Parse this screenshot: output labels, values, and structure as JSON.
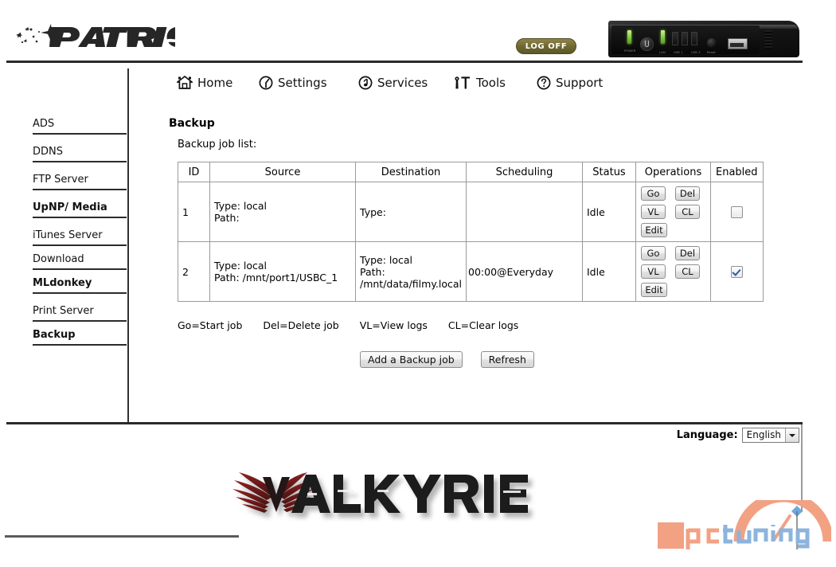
{
  "header": {
    "brand": "PATRIOT",
    "logoff_label": "LOG OFF",
    "device_labels": [
      "POWER",
      "LAN",
      "USB 1",
      "USB 2",
      "Reset"
    ]
  },
  "topnav": [
    {
      "label": "Home",
      "icon": "house-icon"
    },
    {
      "label": "Settings",
      "icon": "clock-icon"
    },
    {
      "label": "Services",
      "icon": "music-note-circle-icon"
    },
    {
      "label": "Tools",
      "icon": "wrench-screwdriver-icon"
    },
    {
      "label": "Support",
      "icon": "question-circle-icon"
    }
  ],
  "sidebar": {
    "items": [
      {
        "label": "ADS",
        "bold": false,
        "active": false
      },
      {
        "label": "DDNS",
        "bold": false,
        "active": false
      },
      {
        "label": "FTP Server",
        "bold": false,
        "active": false
      },
      {
        "label": "UpNP/ Media",
        "bold": true,
        "active": false
      },
      {
        "label": "iTunes Server",
        "bold": false,
        "active": false
      },
      {
        "label": "Download",
        "bold": false,
        "active": false
      },
      {
        "label": "MLdonkey",
        "bold": true,
        "active": false
      },
      {
        "label": "Print Server",
        "bold": false,
        "active": false
      },
      {
        "label": "Backup",
        "bold": true,
        "active": true
      }
    ]
  },
  "main": {
    "title": "Backup",
    "list_label": "Backup job list:",
    "table": {
      "headers": [
        "ID",
        "Source",
        "Destination",
        "Scheduling",
        "Status",
        "Operations",
        "Enabled"
      ],
      "rows": [
        {
          "id": "1",
          "source_type": "Type: local",
          "source_path": "Path:",
          "dest_type": "Type:",
          "dest_path": "",
          "scheduling": "",
          "status": "Idle",
          "enabled": false,
          "ops": [
            "Go",
            "Del",
            "VL",
            "CL",
            "Edit"
          ]
        },
        {
          "id": "2",
          "source_type": "Type: local",
          "source_path": "Path: /mnt/port1/USBC_1",
          "dest_type": "Type: local",
          "dest_path": "Path: /mnt/data/filmy.local",
          "scheduling": "00:00@Everyday",
          "status": "Idle",
          "enabled": true,
          "ops": [
            "Go",
            "Del",
            "VL",
            "CL",
            "Edit"
          ]
        }
      ]
    },
    "legend": [
      "Go=Start job",
      "Del=Delete job",
      "VL=View logs",
      "CL=Clear logs"
    ],
    "actions": {
      "add": "Add a Backup job",
      "refresh": "Refresh"
    }
  },
  "footer": {
    "language_label": "Language:",
    "language_value": "English",
    "brand_logo": "VALKYRIE",
    "watermark": "pctuning"
  },
  "colors": {
    "logoff_bg": "#6e6731",
    "rule": "#2a2a2a",
    "table_border": "#9a9a9a",
    "checkbox_check": "#2f5aa8",
    "valkyrie_wing": "#6b1a1a",
    "valkyrie_text": "#1a1a1a",
    "pct_salmon": "#f2a183",
    "pct_blue": "#8cb4dd"
  }
}
